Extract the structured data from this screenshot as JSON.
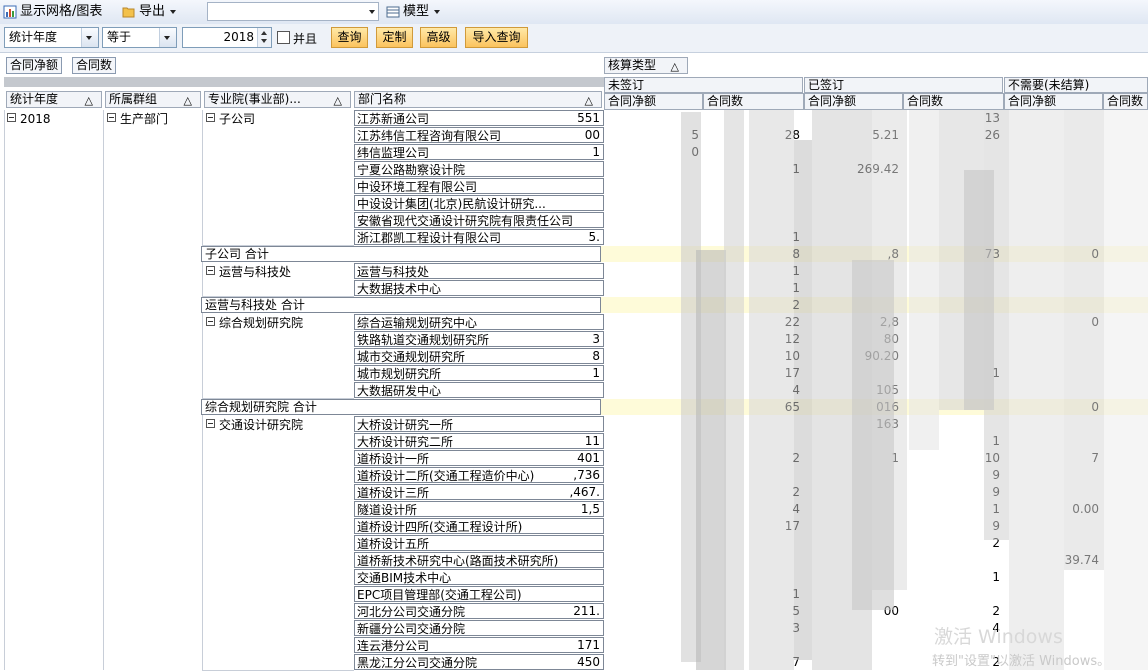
{
  "toolbar": {
    "show_grid_chart": "显示网格/图表",
    "export": "导出",
    "model_combo_value": "",
    "model": "模型"
  },
  "filter": {
    "field": "统计年度",
    "operator": "等于",
    "value": "2018",
    "and_label": "并且",
    "buttons": [
      "查询",
      "定制",
      "高级",
      "导入查询"
    ]
  },
  "data_fields": [
    "合同净额",
    "合同数"
  ],
  "column_field": "核算类型",
  "column_groups": [
    "未签订",
    "已签订",
    "不需要(未结算)"
  ],
  "measure_headers": [
    "合同净额",
    "合同数",
    "合同净额",
    "合同数",
    "合同净额",
    "合同数"
  ],
  "row_headers": [
    "统计年度",
    "所属群组",
    "专业院(事业部)...",
    "部门名称"
  ],
  "sort_glyph": "△",
  "tree": {
    "year": "2018",
    "group": "生产部门",
    "branches": [
      {
        "name": "子公司",
        "total": "子公司 合计"
      },
      {
        "name": "运营与科技处",
        "total": "运营与科技处 合计"
      },
      {
        "name": "综合规划研究院",
        "total": "综合规划研究院 合计"
      },
      {
        "name": "交通设计研究院",
        "total": ""
      }
    ]
  },
  "rows": [
    {
      "dept": "江苏新通公司",
      "v": [
        "551",
        "",
        "",
        "",
        "13",
        "",
        ""
      ]
    },
    {
      "dept": "江苏纬信工程咨询有限公司",
      "v": [
        "00",
        "5",
        "28",
        "5.21",
        "26",
        "",
        ""
      ]
    },
    {
      "dept": "纬信监理公司",
      "v": [
        "1",
        "0",
        "",
        "",
        "",
        "",
        ""
      ]
    },
    {
      "dept": "宁夏公路勘察设计院",
      "v": [
        "",
        "",
        "1",
        "269.42",
        "",
        "",
        ""
      ]
    },
    {
      "dept": "中设环境工程有限公司",
      "v": [
        "",
        "",
        "",
        "",
        "",
        "",
        ""
      ]
    },
    {
      "dept": "中设设计集团(北京)民航设计研究...",
      "v": [
        "",
        "",
        "",
        "",
        "",
        "",
        ""
      ]
    },
    {
      "dept": "安徽省现代交通设计研究院有限责任公司",
      "v": [
        "",
        "",
        "",
        "",
        "",
        "",
        ""
      ]
    },
    {
      "dept": "浙江郡凯工程设计有限公司",
      "v": [
        "5.",
        "",
        "1",
        "",
        "",
        "",
        ""
      ]
    },
    {
      "subtotal": 0,
      "v": [
        "",
        "",
        "8",
        ",8",
        "73",
        "0",
        ""
      ]
    },
    {
      "dept": "运营与科技处",
      "v": [
        "",
        "",
        "1",
        "",
        "",
        "",
        ""
      ]
    },
    {
      "dept": "大数据技术中心",
      "v": [
        "",
        "",
        "1",
        "",
        "",
        "",
        ""
      ]
    },
    {
      "subtotal": 1,
      "v": [
        "",
        "",
        "2",
        "",
        "",
        "",
        ""
      ]
    },
    {
      "dept": "综合运输规划研究中心",
      "v": [
        "",
        "",
        "22",
        "2,8",
        "",
        "0",
        ""
      ]
    },
    {
      "dept": "铁路轨道交通规划研究所",
      "v": [
        "3",
        "",
        "12",
        "80",
        "",
        "",
        ""
      ]
    },
    {
      "dept": "城市交通规划研究所",
      "v": [
        "8",
        "",
        "10",
        "90.20",
        "",
        "",
        ""
      ]
    },
    {
      "dept": "城市规划研究所",
      "v": [
        "1",
        "",
        "17",
        "",
        "1",
        "",
        ""
      ]
    },
    {
      "dept": "大数据研发中心",
      "v": [
        "",
        "",
        "4",
        "105",
        "",
        "",
        ""
      ]
    },
    {
      "subtotal": 2,
      "v": [
        "",
        "",
        "65",
        "016",
        "",
        "0",
        ""
      ]
    },
    {
      "dept": "大桥设计研究一所",
      "v": [
        "",
        "",
        "",
        "163",
        "",
        "",
        ""
      ]
    },
    {
      "dept": "大桥设计研究二所",
      "v": [
        "11",
        "",
        "",
        "",
        "1",
        "",
        ""
      ]
    },
    {
      "dept": "道桥设计一所",
      "v": [
        "401",
        "",
        "2",
        "1",
        "10",
        "7",
        ""
      ]
    },
    {
      "dept": "道桥设计二所(交通工程造价中心)",
      "v": [
        ",736",
        "",
        "",
        "",
        "9",
        "",
        ""
      ]
    },
    {
      "dept": "道桥设计三所",
      "v": [
        ",467.",
        "",
        "2",
        "",
        "9",
        "",
        ""
      ]
    },
    {
      "dept": "隧道设计所",
      "v": [
        "1,5",
        "",
        "4",
        "",
        "1",
        "0.00",
        ""
      ]
    },
    {
      "dept": "道桥设计四所(交通工程设计所)",
      "v": [
        "",
        "",
        "17",
        "",
        "9",
        "",
        ""
      ]
    },
    {
      "dept": "道桥设计五所",
      "v": [
        "",
        "",
        "",
        "",
        "2",
        "",
        ""
      ]
    },
    {
      "dept": "道桥新技术研究中心(路面技术研究所)",
      "v": [
        "",
        "",
        "",
        "",
        "",
        "39.74",
        ""
      ]
    },
    {
      "dept": "交通BIM技术中心",
      "v": [
        "",
        "",
        "",
        "",
        "1",
        "",
        ""
      ]
    },
    {
      "dept": "EPC项目管理部(交通工程公司)",
      "v": [
        "",
        "",
        "1",
        "",
        "",
        "",
        ""
      ]
    },
    {
      "dept": "河北分公司交通分院",
      "v": [
        "211.",
        "",
        "5",
        "00",
        "2",
        "",
        ""
      ]
    },
    {
      "dept": "新疆分公司交通分院",
      "v": [
        "",
        "",
        "3",
        "",
        "4",
        "",
        ""
      ]
    },
    {
      "dept": "连云港分公司",
      "v": [
        "171",
        "",
        "",
        "",
        "",
        "",
        ""
      ]
    },
    {
      "dept": "黑龙江分公司交通分院",
      "v": [
        "450",
        "",
        "7",
        "",
        "2",
        "",
        ""
      ]
    }
  ],
  "watermark": {
    "title": "激活 Windows",
    "subtitle": "转到\"设置\"以激活 Windows。"
  },
  "colors": {
    "subtotal_fill": "#fefbd9",
    "button_fill": "#fbc35e",
    "toolbar": "#dfe7f3"
  }
}
